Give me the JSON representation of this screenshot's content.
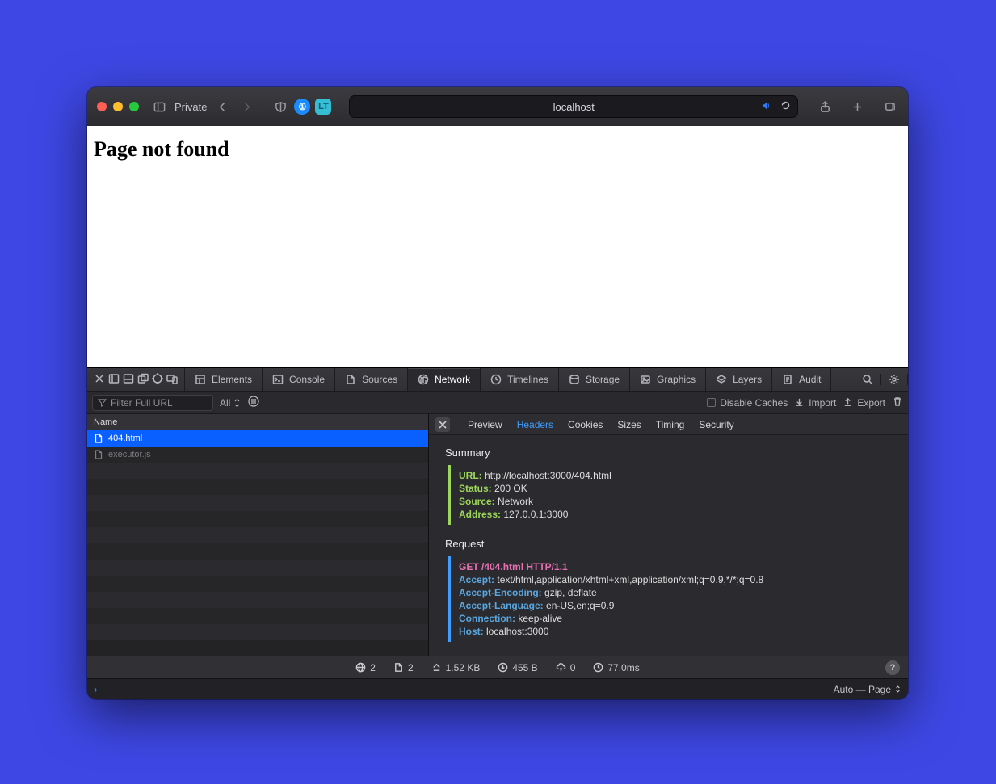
{
  "browser": {
    "private_label": "Private",
    "address_text": "localhost",
    "extensions": {
      "onepassword": "①",
      "lt": "LT"
    }
  },
  "page": {
    "heading": "Page not found"
  },
  "devtools": {
    "tabs": [
      "Elements",
      "Console",
      "Sources",
      "Network",
      "Timelines",
      "Storage",
      "Graphics",
      "Layers",
      "Audit"
    ],
    "active_tab": "Network",
    "network": {
      "filter_placeholder": "Filter Full URL",
      "filter_scope": "All",
      "disable_caches_label": "Disable Caches",
      "import_label": "Import",
      "export_label": "Export",
      "columns": [
        "Name"
      ],
      "rows": [
        {
          "name": "404.html",
          "selected": true,
          "type": "html"
        },
        {
          "name": "executor.js",
          "selected": false,
          "type": "js",
          "faded": true
        }
      ],
      "details": {
        "tabs": [
          "Preview",
          "Headers",
          "Cookies",
          "Sizes",
          "Timing",
          "Security"
        ],
        "active": "Headers",
        "summary_title": "Summary",
        "summary": {
          "URL": "http://localhost:3000/404.html",
          "Status": "200 OK",
          "Source": "Network",
          "Address": "127.0.0.1:3000"
        },
        "request_title": "Request",
        "request_line": "GET /404.html HTTP/1.1",
        "request_headers": {
          "Accept": "text/html,application/xhtml+xml,application/xml;q=0.9,*/*;q=0.8",
          "Accept-Encoding": "gzip, deflate",
          "Accept-Language": "en-US,en;q=0.9",
          "Connection": "keep-alive",
          "Host": "localhost:3000"
        }
      },
      "status": {
        "domains": "2",
        "resources": "2",
        "transferred": "1.52 KB",
        "downloaded": "455 B",
        "uploaded": "0",
        "time": "77.0ms"
      }
    },
    "console_footer": "Auto — Page"
  }
}
